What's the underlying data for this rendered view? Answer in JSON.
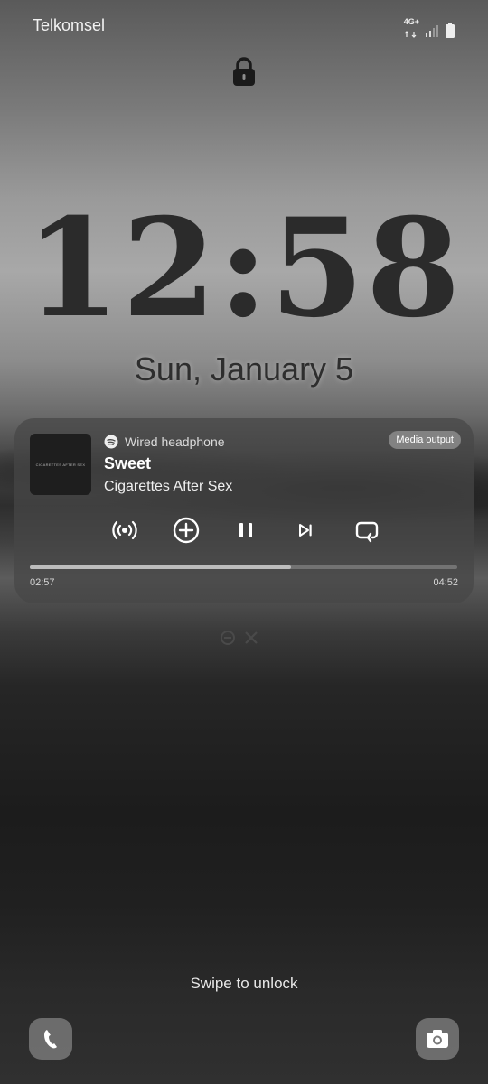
{
  "status_bar": {
    "carrier": "Telkomsel",
    "network": "4G+",
    "icons": [
      "network-4g-plus-icon",
      "signal-icon",
      "battery-icon"
    ]
  },
  "lock_icon": "lock-icon",
  "clock": {
    "time": "12:58",
    "date": "Sun, January 5"
  },
  "media": {
    "album_text": "CIGARETTES AFTER SEX",
    "source_icon": "spotify-icon",
    "source_label": "Wired headphone",
    "output_button": "Media output",
    "title": "Sweet",
    "artist": "Cigarettes After Sex",
    "controls": [
      "broadcast-icon",
      "add-circle-icon",
      "pause-icon",
      "skip-next-icon",
      "repeat-icon"
    ],
    "elapsed": "02:57",
    "duration": "04:52",
    "progress_fraction": 0.61
  },
  "pager_icons": [
    "minus-circle-icon",
    "close-x-icon"
  ],
  "unlock_hint": "Swipe to unlock",
  "shortcuts": {
    "left": "phone-icon",
    "right": "camera-icon"
  },
  "colors": {
    "card_bg": "#464646",
    "accent": "#ffffff"
  }
}
